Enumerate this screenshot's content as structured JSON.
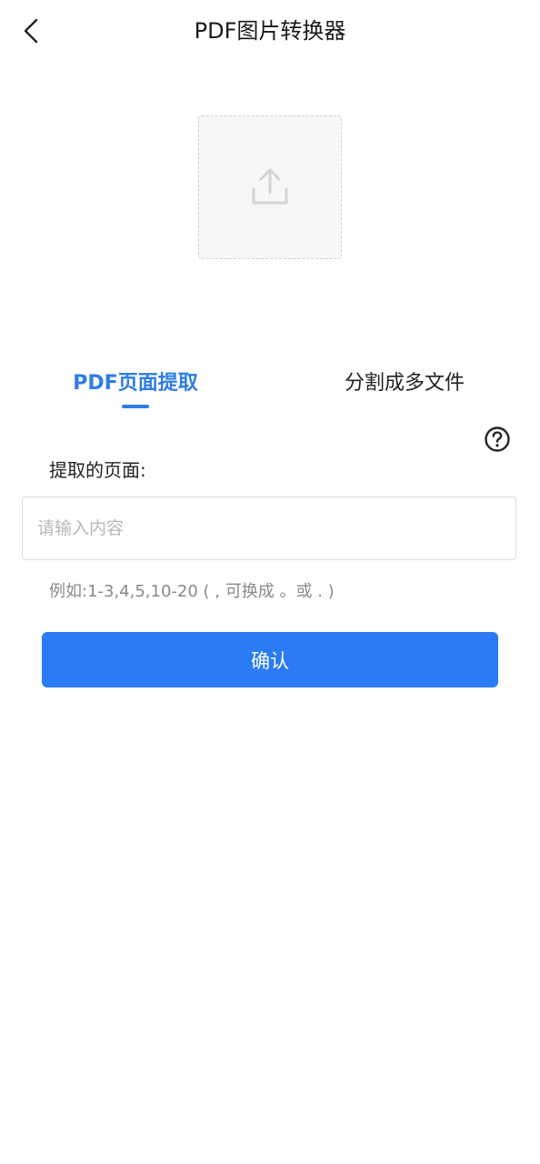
{
  "header": {
    "title": "PDF图片转换器",
    "back_icon": "chevron-left-icon"
  },
  "upload": {
    "icon": "upload-icon"
  },
  "tabs": [
    {
      "label": "PDF页面提取",
      "active": true
    },
    {
      "label": "分割成多文件",
      "active": false
    }
  ],
  "form": {
    "label": "提取的页面:",
    "help_icon": "question-circle-icon",
    "input_value": "",
    "input_placeholder": "请输入内容",
    "hint": "例如:1-3,4,5,10-20 ( , 可换成 。或 . )",
    "confirm_label": "确认"
  },
  "colors": {
    "accent": "#2e7ce6",
    "button": "#2a7bf5",
    "hint_text": "#8a8a8a",
    "placeholder": "#b8b8b8"
  }
}
